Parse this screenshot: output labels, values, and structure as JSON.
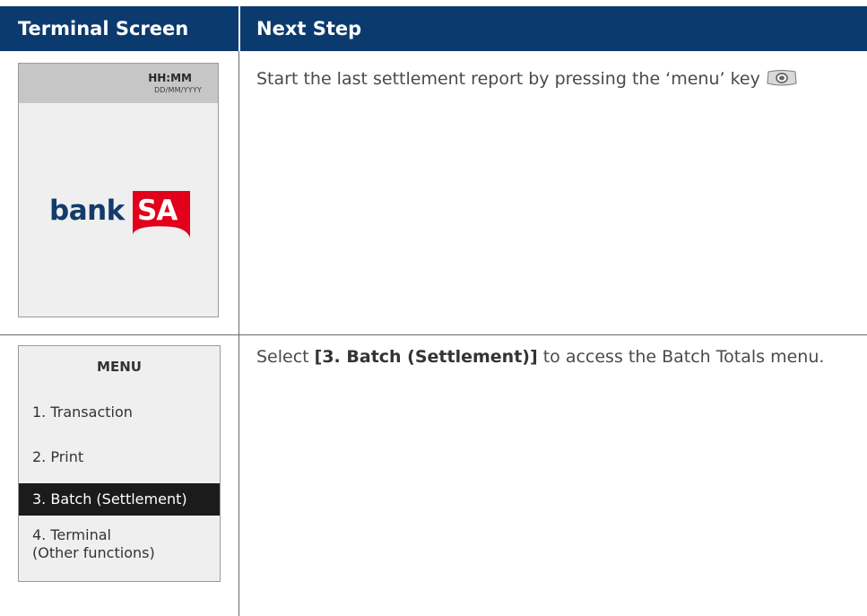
{
  "header": {
    "col1": "Terminal Screen",
    "col2": "Next Step"
  },
  "screen1": {
    "time": "HH:MM",
    "date": "DD/MM/YYYY",
    "logo_text": "bankSA",
    "logo_part1": "bank",
    "logo_part2": "SA"
  },
  "step1": {
    "text_before": "Start the last settlement report by pressing the ‘menu’ key",
    "key_icon": "menu-key-icon"
  },
  "screen2": {
    "title": "MENU",
    "items": [
      {
        "label": "1. Transaction"
      },
      {
        "label": "2. Print"
      },
      {
        "label": "3. Batch (Settlement)",
        "selected": true
      },
      {
        "label": "4. Terminal\n(Other functions)"
      }
    ]
  },
  "step2": {
    "prefix": "Select ",
    "bold": "[3. Batch (Settlement)]",
    "suffix": " to access the Batch Totals menu."
  },
  "colors": {
    "header_bg": "#0b3a6e",
    "logo_blue": "#123b6b",
    "logo_red": "#e2001a",
    "selected_bg": "#1b1b1b"
  }
}
